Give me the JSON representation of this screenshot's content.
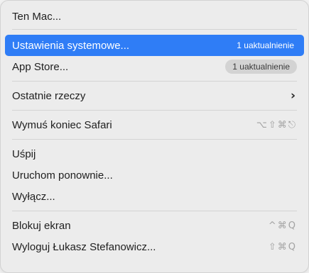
{
  "menu": {
    "items": {
      "about": {
        "label": "Ten Mac..."
      },
      "system_settings": {
        "label": "Ustawienia systemowe...",
        "badge": "1 uaktualnienie"
      },
      "app_store": {
        "label": "App Store...",
        "badge": "1 uaktualnienie"
      },
      "recent_items": {
        "label": "Ostatnie rzeczy",
        "icon": "chevron-right-icon"
      },
      "force_quit": {
        "label": "Wymuś koniec Safari",
        "shortcut": "⌥⇧⌘⎋"
      },
      "sleep": {
        "label": "Uśpij"
      },
      "restart": {
        "label": "Uruchom ponownie..."
      },
      "shutdown": {
        "label": "Wyłącz..."
      },
      "lock_screen": {
        "label": "Blokuj ekran",
        "shortcut": "^⌘Q"
      },
      "logout": {
        "label": "Wyloguj Łukasz Stefanowicz...",
        "shortcut": "⇧⌘Q"
      }
    },
    "colors": {
      "highlight": "#2f7df6",
      "background": "#ececec",
      "shortcut": "#a2a2a2"
    }
  }
}
